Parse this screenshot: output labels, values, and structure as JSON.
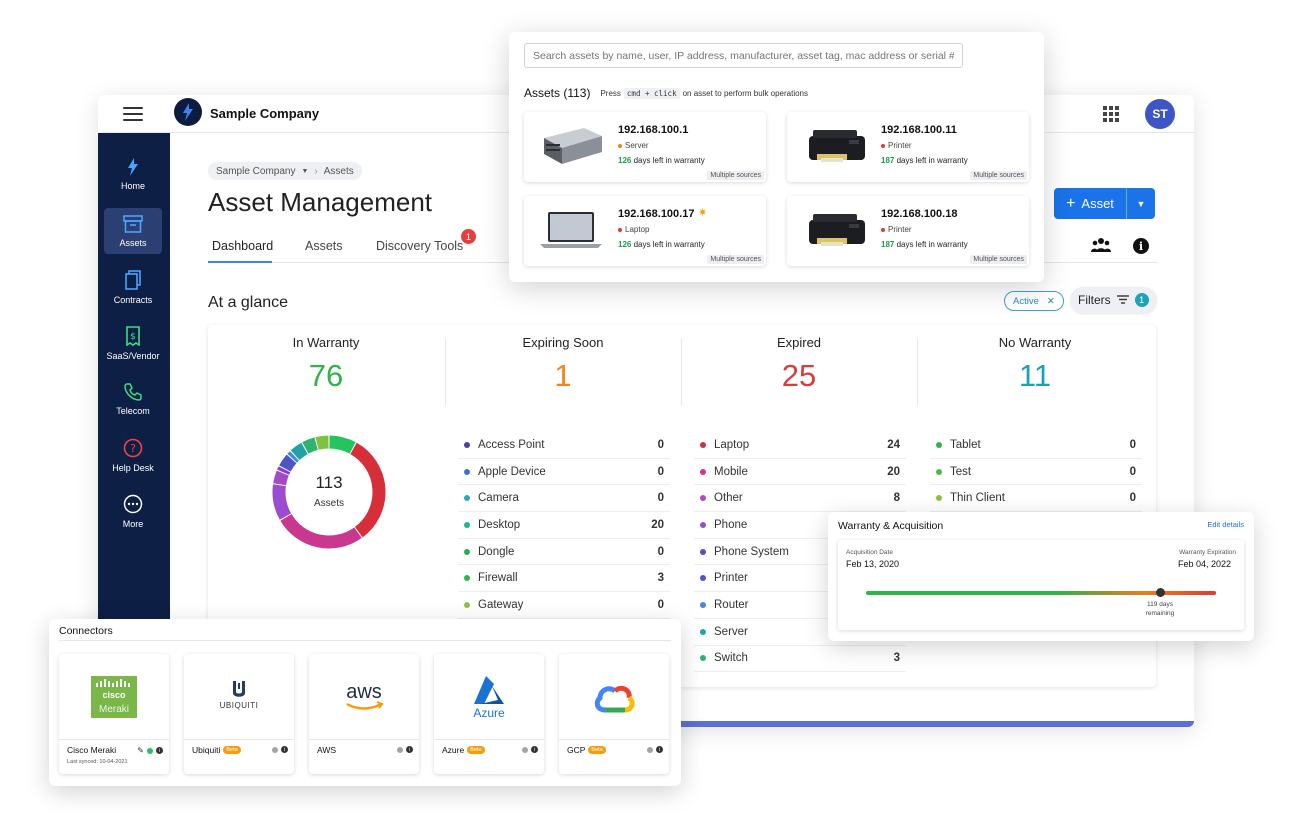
{
  "topbar": {
    "company": "Sample Company",
    "avatar_initials": "ST"
  },
  "sidebar": {
    "items": [
      {
        "label": "Home",
        "icon": "flame-logo-icon"
      },
      {
        "label": "Assets",
        "icon": "archive-box-icon"
      },
      {
        "label": "Contracts",
        "icon": "document-icon"
      },
      {
        "label": "SaaS/Vendor",
        "icon": "receipt-icon"
      },
      {
        "label": "Telecom",
        "icon": "phone-icon"
      },
      {
        "label": "Help Desk",
        "icon": "question-icon"
      },
      {
        "label": "More",
        "icon": "more-dots-icon"
      }
    ]
  },
  "breadcrumb": {
    "company": "Sample Company",
    "current": "Assets"
  },
  "page": {
    "title": "Asset Management",
    "tabs": [
      {
        "label": "Dashboard"
      },
      {
        "label": "Assets"
      },
      {
        "label": "Discovery Tools",
        "badge": "1"
      }
    ],
    "add_button": "Asset",
    "glance_title": "At a glance",
    "active_chip": "Active",
    "filters_label": "Filters",
    "filters_count": "1"
  },
  "stats": [
    {
      "label": "In Warranty",
      "value": "76",
      "color": "#2fb34a"
    },
    {
      "label": "Expiring Soon",
      "value": "1",
      "color": "#f0851a"
    },
    {
      "label": "Expired",
      "value": "25",
      "color": "#dc3b3b"
    },
    {
      "label": "No Warranty",
      "value": "11",
      "color": "#1ba3b3"
    }
  ],
  "donut": {
    "total": "113",
    "label": "Assets",
    "segments": [
      {
        "color": "#22c55e",
        "value": 6
      },
      {
        "color": "#d62f3a",
        "value": 24
      },
      {
        "color": "#c9378f",
        "value": 20
      },
      {
        "color": "#9b4dd1",
        "value": 8
      },
      {
        "color": "#a34bc6",
        "value": 3
      },
      {
        "color": "#9333ea",
        "value": 1
      },
      {
        "color": "#4c55c6",
        "value": 3
      },
      {
        "color": "#3d8bd8",
        "value": 1
      },
      {
        "color": "#1fa3a3",
        "value": 3
      },
      {
        "color": "#2fb36f",
        "value": 3
      },
      {
        "color": "#7fc241",
        "value": 3
      }
    ]
  },
  "categories": {
    "col1": [
      {
        "name": "Access Point",
        "count": "0",
        "color": "#4a3fb8"
      },
      {
        "name": "Apple Device",
        "count": "0",
        "color": "#3b6fd6"
      },
      {
        "name": "Camera",
        "count": "0",
        "color": "#28a9c0"
      },
      {
        "name": "Desktop",
        "count": "20",
        "color": "#20b39a"
      },
      {
        "name": "Dongle",
        "count": "0",
        "color": "#1fae5c"
      },
      {
        "name": "Firewall",
        "count": "3",
        "color": "#2fb34a"
      },
      {
        "name": "Gateway",
        "count": "0",
        "color": "#8cc43f"
      }
    ],
    "col2": [
      {
        "name": "Laptop",
        "count": "24",
        "color": "#d62f3a"
      },
      {
        "name": "Mobile",
        "count": "20",
        "color": "#c9378f"
      },
      {
        "name": "Other",
        "count": "8",
        "color": "#b04bc6"
      },
      {
        "name": "Phone",
        "count": "",
        "color": "#9b4dd1"
      },
      {
        "name": "Phone System",
        "count": "",
        "color": "#6547c9"
      },
      {
        "name": "Printer",
        "count": "",
        "color": "#4c55c6"
      },
      {
        "name": "Router",
        "count": "",
        "color": "#3d8bd8"
      },
      {
        "name": "Server",
        "count": "",
        "color": "#1fa3b8"
      },
      {
        "name": "Switch",
        "count": "3",
        "color": "#2fb36f"
      }
    ],
    "col3": [
      {
        "name": "Tablet",
        "count": "0",
        "color": "#2fb34a"
      },
      {
        "name": "Test",
        "count": "0",
        "color": "#4fb84a"
      },
      {
        "name": "Thin Client",
        "count": "0",
        "color": "#8cc43f"
      }
    ]
  },
  "search": {
    "placeholder": "Search assets by name, user, IP address, manufacturer, asset tag, mac address or serial #",
    "heading": "Assets (113)",
    "hint_press": "Press",
    "hint_keys": "cmd + click",
    "hint_rest": "on asset to perform bulk operations",
    "results": [
      {
        "ip": "192.168.100.1",
        "type": "Server",
        "type_color": "#f0851a",
        "days": "126",
        "days_text": "days left in warranty",
        "source": "Multiple sources",
        "thumb": "server-icon"
      },
      {
        "ip": "192.168.100.11",
        "type": "Printer",
        "type_color": "#dc3b3b",
        "days": "187",
        "days_text": "days left in warranty",
        "source": "Multiple sources",
        "thumb": "printer-icon"
      },
      {
        "ip": "192.168.100.17",
        "type": "Laptop",
        "type_color": "#dc3b3b",
        "days": "126",
        "days_text": "days left in warranty",
        "source": "Multiple sources",
        "thumb": "laptop-icon"
      },
      {
        "ip": "192.168.100.18",
        "type": "Printer",
        "type_color": "#dc3b3b",
        "days": "187",
        "days_text": "days left in warranty",
        "source": "Multiple sources",
        "thumb": "printer-icon"
      }
    ]
  },
  "warranty": {
    "title": "Warranty & Acquisition",
    "edit": "Edit details",
    "acq_label": "Acquisition Date",
    "acq_date": "Feb 13, 2020",
    "exp_label": "Warranty Expiration",
    "exp_date": "Feb 04, 2022",
    "remaining_line1": "119 days",
    "remaining_line2": "remaining",
    "elapsed_fraction": 0.84
  },
  "connectors": {
    "title": "Connectors",
    "beta_label": "Beta",
    "items": [
      {
        "name": "Cisco Meraki",
        "sync": "Last synced: 10-04-2021",
        "status_color": "#22c55e",
        "logo": "cisco-meraki-logo"
      },
      {
        "name": "Ubiquiti",
        "beta": true,
        "status_color": "#a0a4ab",
        "logo": "ubiquiti-logo"
      },
      {
        "name": "AWS",
        "status_color": "#a0a4ab",
        "logo": "aws-logo"
      },
      {
        "name": "Azure",
        "beta": true,
        "status_color": "#a0a4ab",
        "logo": "azure-logo"
      },
      {
        "name": "GCP",
        "beta": true,
        "status_color": "#a0a4ab",
        "logo": "gcp-logo"
      }
    ],
    "logo_text": {
      "cisco": "cisco",
      "meraki": "Meraki",
      "ubiquiti": "UBIQUITI",
      "aws": "aws",
      "azure": "Azure"
    }
  }
}
